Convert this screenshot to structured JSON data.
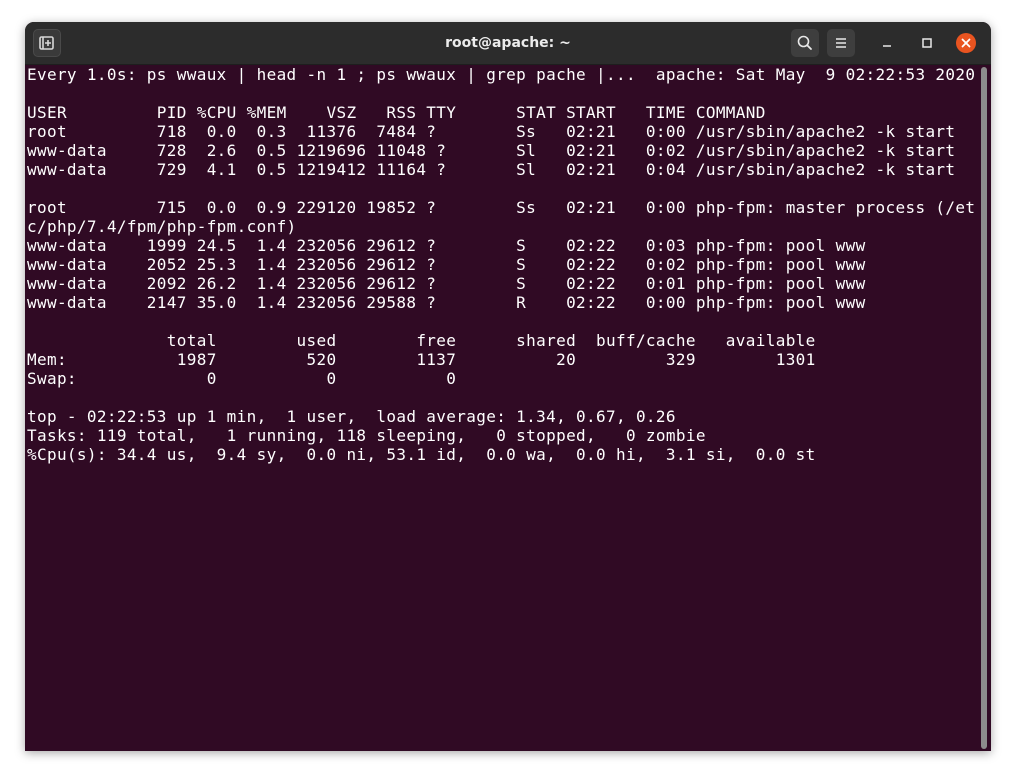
{
  "window": {
    "title": "root@apache: ~"
  },
  "titlebar": {
    "new_tab_icon": "new-tab-icon",
    "search_icon": "search-icon",
    "menu_icon": "hamburger-menu-icon",
    "minimize_icon": "minimize-icon",
    "maximize_icon": "maximize-icon",
    "close_icon": "close-icon",
    "close_color": "#e95420"
  },
  "terminal": {
    "background": "#300a24",
    "lines": [
      "Every 1.0s: ps wwaux | head -n 1 ; ps wwaux | grep pache |...  apache: Sat May  9 02:22:53 2020",
      "",
      "USER         PID %CPU %MEM    VSZ   RSS TTY      STAT START   TIME COMMAND",
      "root         718  0.0  0.3  11376  7484 ?        Ss   02:21   0:00 /usr/sbin/apache2 -k start",
      "www-data     728  2.6  0.5 1219696 11048 ?       Sl   02:21   0:02 /usr/sbin/apache2 -k start",
      "www-data     729  4.1  0.5 1219412 11164 ?       Sl   02:21   0:04 /usr/sbin/apache2 -k start",
      "",
      "root         715  0.0  0.9 229120 19852 ?        Ss   02:21   0:00 php-fpm: master process (/et",
      "c/php/7.4/fpm/php-fpm.conf)",
      "www-data    1999 24.5  1.4 232056 29612 ?        S    02:22   0:03 php-fpm: pool www",
      "www-data    2052 25.3  1.4 232056 29612 ?        S    02:22   0:02 php-fpm: pool www",
      "www-data    2092 26.2  1.4 232056 29612 ?        S    02:22   0:01 php-fpm: pool www",
      "www-data    2147 35.0  1.4 232056 29588 ?        R    02:22   0:00 php-fpm: pool www",
      "",
      "              total        used        free      shared  buff/cache   available",
      "Mem:           1987         520        1137          20         329        1301",
      "Swap:             0           0           0",
      "",
      "top - 02:22:53 up 1 min,  1 user,  load average: 1.34, 0.67, 0.26",
      "Tasks: 119 total,   1 running, 118 sleeping,   0 stopped,   0 zombie",
      "%Cpu(s): 34.4 us,  9.4 sy,  0.0 ni, 53.1 id,  0.0 wa,  0.0 hi,  3.1 si,  0.0 st"
    ]
  }
}
